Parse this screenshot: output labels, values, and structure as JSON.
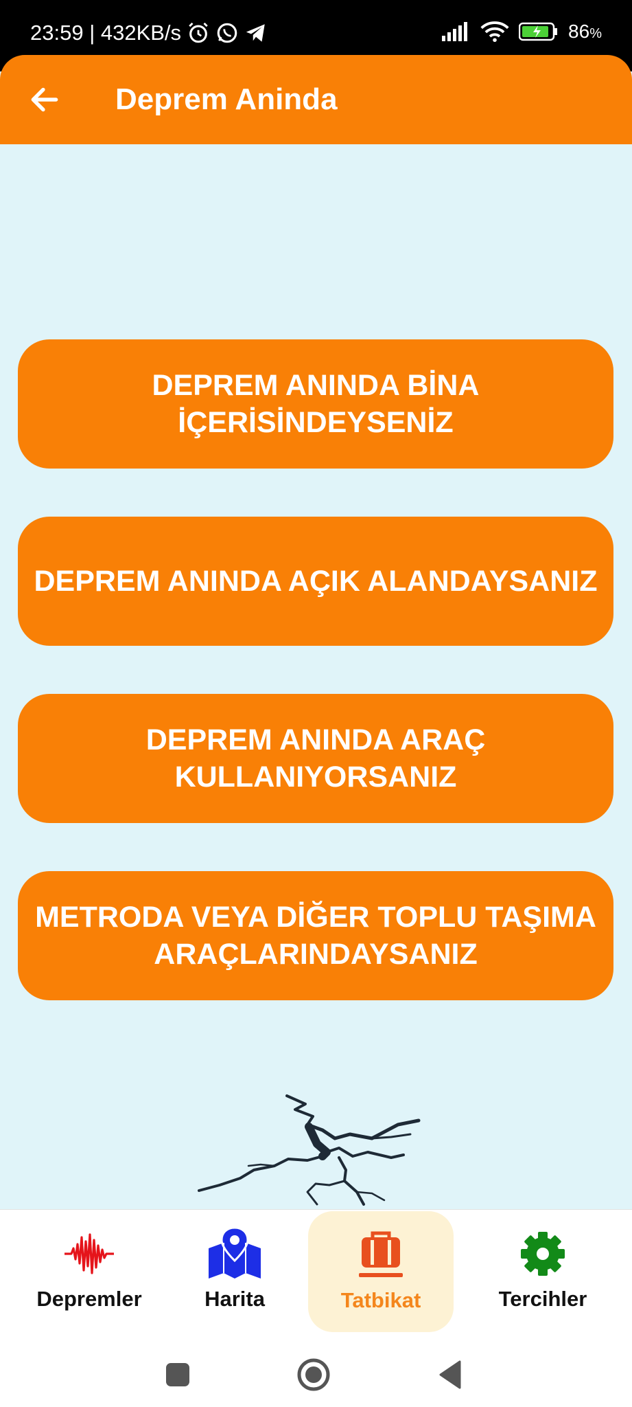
{
  "status": {
    "time_speed": "23:59 | 432KB/s",
    "battery": "86",
    "battery_unit": "%"
  },
  "appbar": {
    "title": "Deprem Aninda"
  },
  "buttons": [
    {
      "line1": "DEPREM ANINDA BİNA",
      "line2": "İÇERİSİNDEYSENİZ"
    },
    {
      "line1": "DEPREM ANINDA AÇIK ALANDAYSANIZ",
      "line2": ""
    },
    {
      "line1": "DEPREM ANINDA ARAÇ",
      "line2": "KULLANIYORSANIZ"
    },
    {
      "line1": "METRODA VEYA DİĞER TOPLU TAŞIMA",
      "line2": "ARAÇLARINDAYSANIZ"
    }
  ],
  "bottom_nav": {
    "items": [
      {
        "label": "Depremler",
        "icon": "seismic-wave-icon"
      },
      {
        "label": "Harita",
        "icon": "map-icon"
      },
      {
        "label": "Tatbikat",
        "icon": "briefcase-icon"
      },
      {
        "label": "Tercihler",
        "icon": "gear-icon"
      }
    ],
    "active": "Tatbikat"
  },
  "colors": {
    "accent": "#f98006",
    "background": "#e0f4f9",
    "active_nav_bg": "#fdf2d4",
    "active_nav_text": "#f4861c",
    "depremler_icon": "#e5141b",
    "harita_icon": "#1d2ee6",
    "tatbikat_icon": "#e8501e",
    "tercihler_icon": "#128a18"
  }
}
